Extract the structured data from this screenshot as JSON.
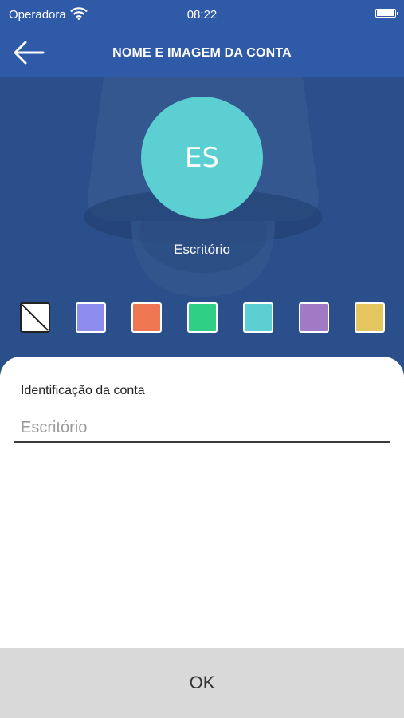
{
  "status_bar": {
    "carrier": "Operadora",
    "time": "08:22"
  },
  "header": {
    "title": "NOME E IMAGEM DA CONTA",
    "back_icon": "arrow-left-icon"
  },
  "profile": {
    "initials": "ES",
    "name": "Escritório",
    "avatar_color": "#5ccfd2"
  },
  "color_options": [
    {
      "id": "none",
      "color": "#ffffff"
    },
    {
      "id": "lavender",
      "color": "#8f8cf0"
    },
    {
      "id": "orange",
      "color": "#ee7650"
    },
    {
      "id": "green",
      "color": "#2fcf85"
    },
    {
      "id": "cyan",
      "color": "#5ccfd2"
    },
    {
      "id": "purple",
      "color": "#a07ac4"
    },
    {
      "id": "yellow",
      "color": "#e3c65d"
    }
  ],
  "form": {
    "label": "Identificação da conta",
    "placeholder": "Escritório",
    "value": ""
  },
  "footer": {
    "ok_label": "OK"
  },
  "theme": {
    "primary": "#2f5aa8",
    "hero_bg": "#2b4f8a",
    "footer_bg": "#d9d9d9"
  }
}
